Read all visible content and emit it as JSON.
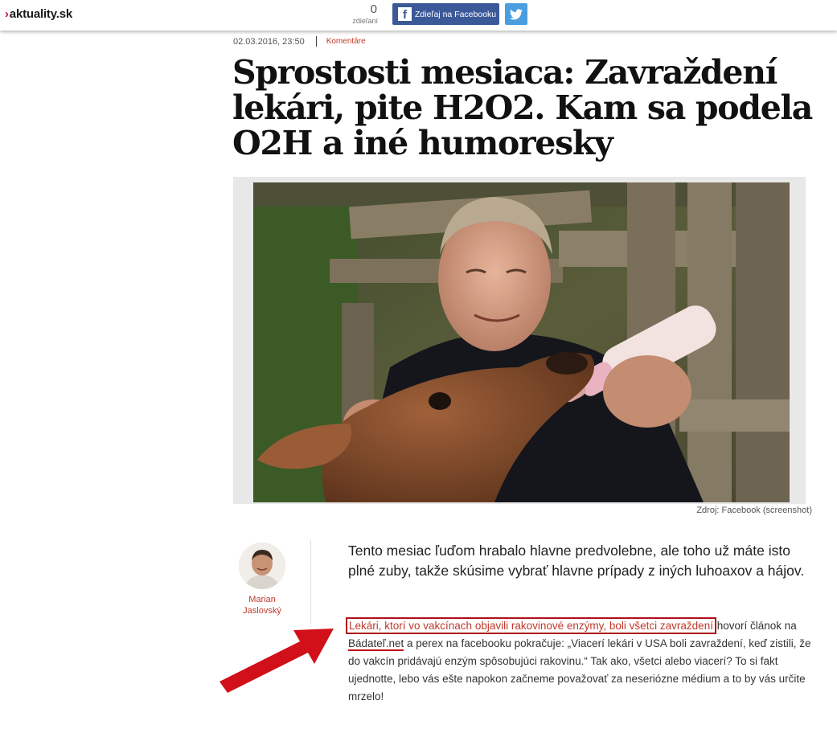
{
  "header": {
    "logo_text": "aktuality.sk",
    "share_count": "0",
    "share_label": "zdieľaní",
    "fb_button_label": "Zdieľaj na Facebooku",
    "fb_icon_glyph": "f"
  },
  "article": {
    "date": "02.03.2016, 23:50",
    "comments_label": "Komentáre",
    "title": "Sprostosti mesiaca: Zavraždení lekári, pite H2O2. Kam sa podela O2H a iné humoresky",
    "image_caption": "Zdroj: Facebook (screenshot)",
    "author_first": "Marian",
    "author_last": "Jaslovský",
    "lead": "Tento mesiac ľuďom hrabalo hlavne predvolebne, ale toho už máte isto plné zuby, takže skúsime vybrať hlavne prípady z iných luhoaxov a hájov.",
    "body": {
      "link_text": "Lekári, ktorí vo vakcínach objavili rakovinové enzýmy, boli všetci zavraždení",
      "text1": " hovorí článok na ",
      "source_link": "Bádateľ.net",
      "text2": " a perex na facebooku pokračuje: „Viacerí lekári v USA boli zavraždení, keď zistili, že do vakcín pridávajú enzým spôsobujúci rakovinu.“ Tak ako, všetci alebo viacerí? To si fakt ujednotte, lebo vás ešte napokon začneme považovať za neseriózne médium a to by vás určite mrzelo!"
    }
  },
  "colors": {
    "accent_red": "#c0392b",
    "facebook_blue": "#3b5998",
    "twitter_blue": "#4b9de0",
    "annotation_red": "#b0101a"
  },
  "icons": [
    "facebook-icon",
    "twitter-icon",
    "annotation-arrow"
  ]
}
